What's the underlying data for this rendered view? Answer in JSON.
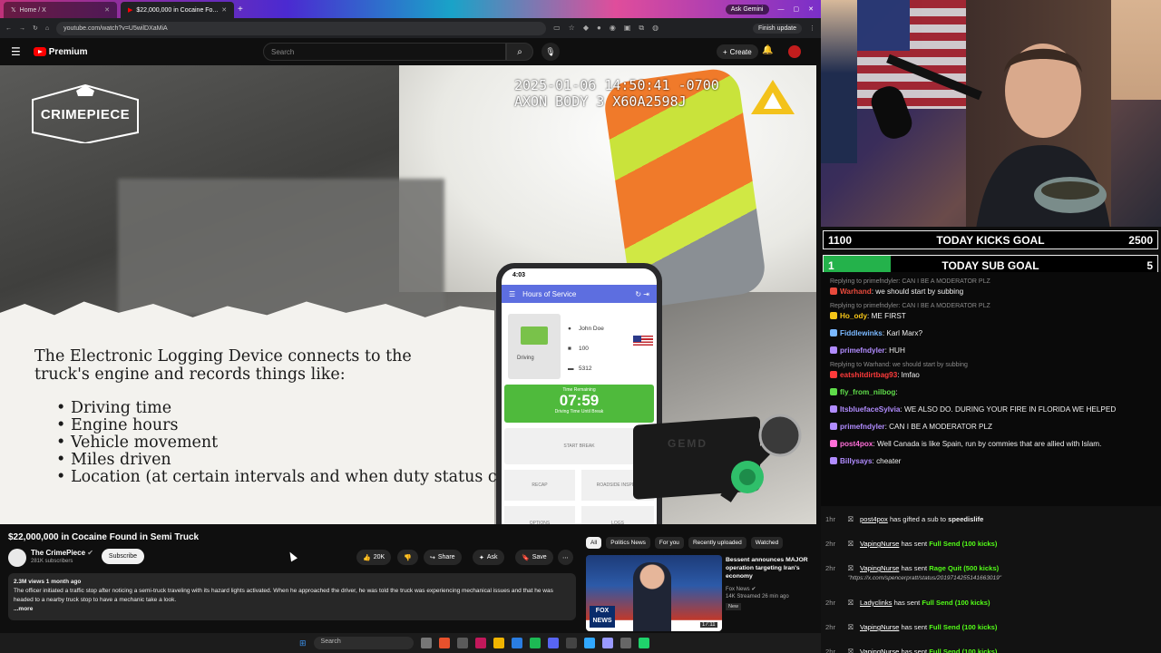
{
  "browser": {
    "tabs": [
      {
        "title": "Home / X"
      },
      {
        "title": "$22,000,000 in Cocaine Fo..."
      }
    ],
    "gemini_label": "Ask Gemini",
    "url": "youtube.com/watch?v=U5wilDXaMiA",
    "finish_update": "Finish update"
  },
  "youtube": {
    "logo_text": "Premium",
    "search_placeholder": "Search",
    "create_label": "Create"
  },
  "video": {
    "channel_logo_text": "CRIMEPIECE",
    "timestamp_line1": "2025-01-06 14:50:41 -0700",
    "timestamp_line2": "AXON BODY 3 X60A2598J",
    "slide_title": "The Electronic Logging Device connects to the truck's engine and records things like:",
    "slide_items": [
      "Driving time",
      "Engine hours",
      "Vehicle movement",
      "Miles driven",
      "Location (at certain intervals and when duty status changes)"
    ],
    "phone": {
      "time": "4:03",
      "header": "Hours of Service",
      "driver": "John Doe",
      "truck_no": "100",
      "trailer_no": "5312",
      "driving_label": "Driving",
      "timer_caption": "Time Remaining",
      "timer": "07:59",
      "timer_sub": "Driving Time Until Break",
      "start_break": "START BREAK",
      "recap": "RECAP",
      "roadside": "ROADSIDE INSPE...",
      "options": "OPTIONS",
      "logs": "LOGS"
    },
    "device_label": "GEMD"
  },
  "video_info": {
    "title": "$22,000,000 in Cocaine Found in Semi Truck",
    "channel": "The CrimePiece",
    "subscribers": "281K subscribers",
    "subscribe_label": "Subscribe",
    "likes": "20K",
    "share_label": "Share",
    "ask_label": "Ask",
    "save_label": "Save",
    "meta": "2.3M views  1 month ago",
    "description": "The officer initiated a traffic stop after noticing a semi-truck traveling with its hazard lights activated. When he approached the driver, he was told the truck was experiencing mechanical issues and that he was headed to a nearby truck stop to have a mechanic take a look.",
    "more": "...more"
  },
  "recommendations": {
    "chips": [
      "All",
      "Politics News",
      "For you",
      "Recently uploaded",
      "Watched"
    ],
    "item": {
      "title": "Bessent announces MAJOR operation targeting Iran's economy",
      "channel": "Fox News",
      "views": "14K  Streamed 26 min ago",
      "badge": "New",
      "duration": "17:11",
      "thumb_label": "FOX NEWS"
    }
  },
  "taskbar": {
    "search": "Search"
  },
  "goals": [
    {
      "low": "1100",
      "label": "TODAY KICKS GOAL",
      "high": "2500",
      "progress": 0
    },
    {
      "low": "1",
      "label": "TODAY SUB GOAL",
      "high": "5",
      "progress": 0.2
    }
  ],
  "chat": [
    {
      "reply": "Replying to primefndyler: CAN I BE A MODERATOR PLZ",
      "user": "Warhand",
      "user_color": "#e84a3c",
      "msg": ": we should start by subbing"
    },
    {
      "reply": "Replying to primefndyler: CAN I BE A MODERATOR PLZ",
      "user": "Ho_ody",
      "user_color": "#f5c518",
      "msg": ": ME FIRST"
    },
    {
      "reply": "",
      "user": "Fiddlewinks",
      "user_color": "#7ab8ff",
      "msg": ": Karl Marx?"
    },
    {
      "reply": "",
      "user": "primefndyler",
      "user_color": "#b18cff",
      "msg": ": HUH"
    },
    {
      "reply": "Replying to Warhand: we should start by subbing",
      "user": "eatshitdirtbag93",
      "user_color": "#ff3b3b",
      "msg": ": lmfao"
    },
    {
      "reply": "",
      "user": "fly_from_nilbog",
      "user_color": "#5fdc4a",
      "msg": ":"
    },
    {
      "reply": "",
      "user": "ItsbluefaceSylvia",
      "user_color": "#b18cff",
      "msg": ": WE ALSO DO. DURING YOUR FIRE IN FLORIDA WE HELPED"
    },
    {
      "reply": "",
      "user": "primefndyler",
      "user_color": "#b18cff",
      "msg": ": CAN I BE A MODERATOR PLZ"
    },
    {
      "reply": "",
      "user": "post4pox",
      "user_color": "#ff6fd8",
      "msg": ": Well Canada is like Spain, run by commies that are allied with Islam."
    },
    {
      "reply": "",
      "user": "Billysays",
      "user_color": "#b18cff",
      "msg": ": cheater"
    }
  ],
  "alerts": [
    {
      "time": "1hr",
      "user": "post4pox",
      "pre": "",
      "text": " has gifted a sub to ",
      "highlight": "",
      "tail": "speedislife",
      "sub": ""
    },
    {
      "time": "2hr",
      "user": "VapingNurse",
      "pre": "",
      "text": " has sent ",
      "highlight": "Full Send (100 kicks)",
      "tail": "",
      "sub": ""
    },
    {
      "time": "2hr",
      "user": "VapingNurse",
      "pre": "",
      "text": " has sent ",
      "highlight": "Rage Quit (500 kicks)",
      "tail": "",
      "sub": "\"https://x.com/spencerpratt/status/2019714255141663019\""
    },
    {
      "time": "2hr",
      "user": "Ladyclinks",
      "pre": "",
      "text": " has sent ",
      "highlight": "Full Send (100 kicks)",
      "tail": "",
      "sub": ""
    },
    {
      "time": "2hr",
      "user": "VapingNurse",
      "pre": "",
      "text": " has sent ",
      "highlight": "Full Send (100 kicks)",
      "tail": "",
      "sub": ""
    },
    {
      "time": "2hr",
      "user": "VapingNurse",
      "pre": "",
      "text": " has sent ",
      "highlight": "Full Send (100 kicks)",
      "tail": "",
      "sub": ""
    }
  ],
  "colors": {
    "accent_red": "#ff0000",
    "kick_green": "#53fc18",
    "goal_fill": "#24b24b"
  }
}
